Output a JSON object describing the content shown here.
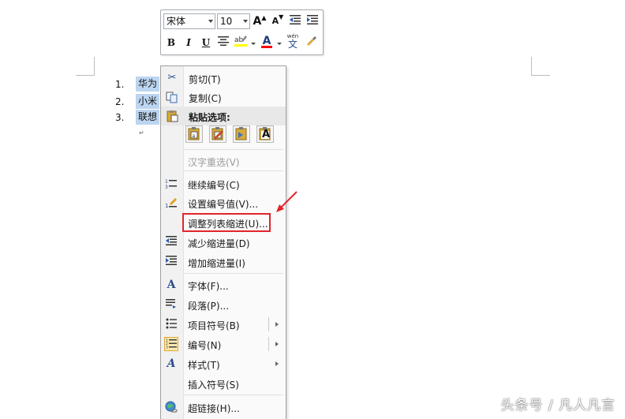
{
  "document": {
    "list": [
      {
        "num": "1.",
        "text": "华为"
      },
      {
        "num": "2.",
        "text": "小米"
      },
      {
        "num": "3.",
        "text": "联想"
      }
    ],
    "para_mark": "↵"
  },
  "mini_toolbar": {
    "font_name": "宋体",
    "font_size": "10",
    "bold": "B",
    "italic": "I",
    "underline": "U",
    "font_color_glyph": "A",
    "grow_font_glyph": "A",
    "shrink_font_glyph": "A",
    "phonetic_top": "wén",
    "phonetic_char": "文",
    "colors": {
      "highlight": "#ffff00",
      "font_color": "#ff0000"
    }
  },
  "context_menu": {
    "cut": "剪切(T)",
    "copy": "复制(C)",
    "paste_options": "粘贴选项:",
    "paste_buttons": [
      "keep-source-format-icon",
      "merge-format-icon",
      "keep-list-icon",
      "keep-text-only-icon"
    ],
    "paste_text_only_glyph": "A",
    "hanzi_reconvert": "汉字重选(V)",
    "continue_numbering": "继续编号(C)",
    "set_numbering_value": "设置编号值(V)...",
    "adjust_list_indent": "调整列表缩进(U)...",
    "decrease_indent": "减少缩进量(D)",
    "increase_indent": "增加缩进量(I)",
    "font": "字体(F)...",
    "paragraph": "段落(P)...",
    "bullets": "项目符号(B)",
    "numbering": "编号(N)",
    "styles": "样式(T)",
    "insert_symbol": "插入符号(S)",
    "hyperlink": "超链接(H)..."
  },
  "annotation": {
    "highlight_color": "#e3242b"
  },
  "watermark": "头条号 / 凡人凡言"
}
